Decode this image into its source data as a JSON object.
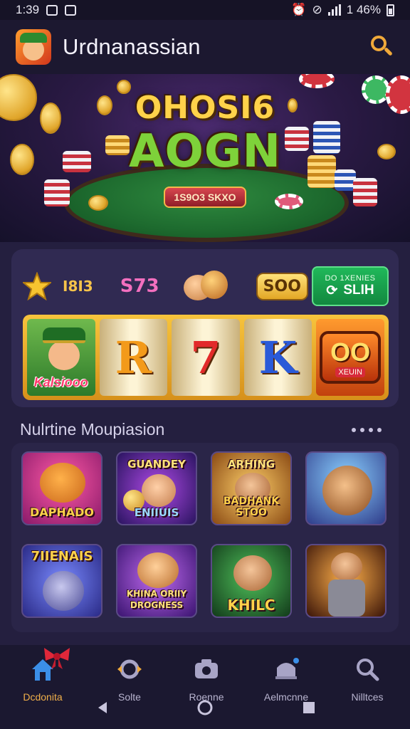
{
  "status_bar": {
    "time": "1:39",
    "battery_text": "1 46%",
    "icons": [
      "notification-icon",
      "gallery-icon",
      "alarm-icon",
      "mute-icon",
      "signal-icon",
      "battery-icon"
    ]
  },
  "header": {
    "app_name": "Urdnanassian",
    "logo_icon": "leprechaun-logo",
    "search_icon": "search-icon",
    "accent_color": "#f0a93a"
  },
  "hero": {
    "line1": "OHOSI6",
    "line2": "AOGN",
    "pill": "1S9O3 SKXO"
  },
  "slot": {
    "stat_1": "I8I3",
    "stat_2": "S73",
    "stat_3": "SOO",
    "spin_top": "DO 1XENIES",
    "spin_main": "SLIH",
    "reel_1_label": "Kalsiooo",
    "reel_2_symbol": "R",
    "reel_3_symbol": "7",
    "reel_4_symbol": "K",
    "reel_5_eyes": "OO",
    "reel_5_label": "XEUIN"
  },
  "games_section": {
    "title": "Nulrtine Moupiasion",
    "games": [
      {
        "name": "DAPHADO",
        "colors": [
          "#d8307a",
          "#6a1a5a"
        ]
      },
      {
        "name": "GUANDEY",
        "name_bottom": "ENIIUIS",
        "colors": [
          "#8a3ad2",
          "#2a1460"
        ]
      },
      {
        "name": "ARHING",
        "name_bottom": "BADHANK STOO",
        "colors": [
          "#f0a23a",
          "#7a3a10"
        ]
      },
      {
        "name": "",
        "colors": [
          "#3a9ad8",
          "#2f3c8a"
        ]
      },
      {
        "name": "7IIENAIS",
        "colors": [
          "#5a7ae8",
          "#2a2a86"
        ]
      },
      {
        "name": "KHINA ORIIY DROGNESS",
        "colors": [
          "#a04ae0",
          "#3a1470"
        ]
      },
      {
        "name": "KHILC",
        "colors": [
          "#2f9a3a",
          "#123a1a"
        ]
      },
      {
        "name": "",
        "colors": [
          "#f0822a",
          "#3a1408"
        ]
      }
    ]
  },
  "bottom_nav": {
    "items": [
      {
        "label": "Dcdonita",
        "icon": "home-icon",
        "active": true
      },
      {
        "label": "Solte",
        "icon": "slot-icon",
        "active": false
      },
      {
        "label": "Roenne",
        "icon": "camera-icon",
        "active": false
      },
      {
        "label": "Aelmcnne",
        "icon": "cart-icon",
        "active": false
      },
      {
        "label": "Nilltces",
        "icon": "search-icon",
        "active": false
      }
    ]
  }
}
